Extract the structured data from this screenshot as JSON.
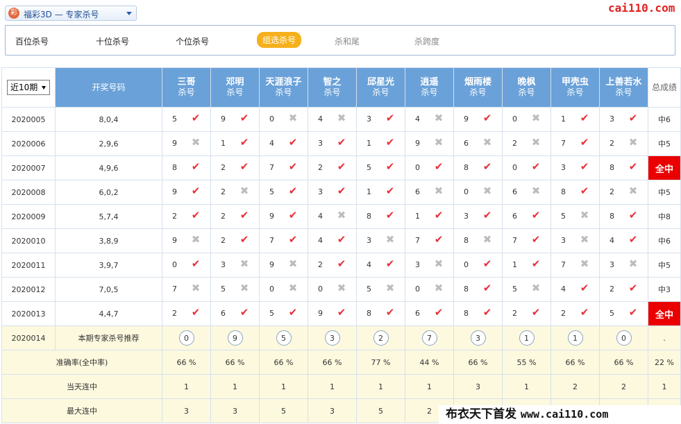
{
  "header": {
    "logo_glyph": "彩",
    "lottery_label": "福彩3D — 专家杀号",
    "brand": "cai110.com"
  },
  "tabs": [
    {
      "label": "百位杀号",
      "state": "normal"
    },
    {
      "label": "十位杀号",
      "state": "normal"
    },
    {
      "label": "个位杀号",
      "state": "normal"
    },
    {
      "label": "组选杀号",
      "state": "active"
    },
    {
      "label": "杀和尾",
      "state": "muted"
    },
    {
      "label": "杀跨度",
      "state": "muted"
    }
  ],
  "table": {
    "period_filter": "近10期",
    "draw_header": "开奖号码",
    "total_header": "总成绩",
    "kill_label": "杀号",
    "experts": [
      "三哥",
      "邓明",
      "天涯浪子",
      "智之",
      "邱星光",
      "逍遥",
      "烟雨楼",
      "晚枫",
      "甲壳虫",
      "上善若水"
    ],
    "rows": [
      {
        "period": "2020005",
        "draw": "8,0,4",
        "cells": [
          [
            "5",
            "hit"
          ],
          [
            "9",
            "hit"
          ],
          [
            "0",
            "miss"
          ],
          [
            "4",
            "miss"
          ],
          [
            "3",
            "hit"
          ],
          [
            "4",
            "miss"
          ],
          [
            "9",
            "hit"
          ],
          [
            "0",
            "miss"
          ],
          [
            "1",
            "hit"
          ],
          [
            "3",
            "hit"
          ]
        ],
        "total": "中6",
        "full": false
      },
      {
        "period": "2020006",
        "draw": "2,9,6",
        "cells": [
          [
            "9",
            "miss"
          ],
          [
            "1",
            "hit"
          ],
          [
            "4",
            "hit"
          ],
          [
            "3",
            "hit"
          ],
          [
            "1",
            "hit"
          ],
          [
            "9",
            "miss"
          ],
          [
            "6",
            "miss"
          ],
          [
            "2",
            "miss"
          ],
          [
            "7",
            "hit"
          ],
          [
            "2",
            "miss"
          ]
        ],
        "total": "中5",
        "full": false
      },
      {
        "period": "2020007",
        "draw": "4,9,6",
        "cells": [
          [
            "8",
            "hit"
          ],
          [
            "2",
            "hit"
          ],
          [
            "7",
            "hit"
          ],
          [
            "2",
            "hit"
          ],
          [
            "5",
            "hit"
          ],
          [
            "0",
            "hit"
          ],
          [
            "8",
            "hit"
          ],
          [
            "0",
            "hit"
          ],
          [
            "3",
            "hit"
          ],
          [
            "8",
            "hit"
          ]
        ],
        "total": "全中",
        "full": true
      },
      {
        "period": "2020008",
        "draw": "6,0,2",
        "cells": [
          [
            "9",
            "hit"
          ],
          [
            "2",
            "miss"
          ],
          [
            "5",
            "hit"
          ],
          [
            "3",
            "hit"
          ],
          [
            "1",
            "hit"
          ],
          [
            "6",
            "miss"
          ],
          [
            "0",
            "miss"
          ],
          [
            "6",
            "miss"
          ],
          [
            "8",
            "hit"
          ],
          [
            "2",
            "miss"
          ]
        ],
        "total": "中5",
        "full": false
      },
      {
        "period": "2020009",
        "draw": "5,7,4",
        "cells": [
          [
            "2",
            "hit"
          ],
          [
            "2",
            "hit"
          ],
          [
            "9",
            "hit"
          ],
          [
            "4",
            "miss"
          ],
          [
            "8",
            "hit"
          ],
          [
            "1",
            "hit"
          ],
          [
            "3",
            "hit"
          ],
          [
            "6",
            "hit"
          ],
          [
            "5",
            "miss"
          ],
          [
            "8",
            "hit"
          ]
        ],
        "total": "中8",
        "full": false
      },
      {
        "period": "2020010",
        "draw": "3,8,9",
        "cells": [
          [
            "9",
            "miss"
          ],
          [
            "2",
            "hit"
          ],
          [
            "7",
            "hit"
          ],
          [
            "4",
            "hit"
          ],
          [
            "3",
            "miss"
          ],
          [
            "7",
            "hit"
          ],
          [
            "8",
            "miss"
          ],
          [
            "7",
            "hit"
          ],
          [
            "3",
            "miss"
          ],
          [
            "4",
            "hit"
          ]
        ],
        "total": "中6",
        "full": false
      },
      {
        "period": "2020011",
        "draw": "3,9,7",
        "cells": [
          [
            "0",
            "hit"
          ],
          [
            "3",
            "miss"
          ],
          [
            "9",
            "miss"
          ],
          [
            "2",
            "hit"
          ],
          [
            "4",
            "hit"
          ],
          [
            "3",
            "miss"
          ],
          [
            "0",
            "hit"
          ],
          [
            "1",
            "hit"
          ],
          [
            "7",
            "miss"
          ],
          [
            "3",
            "miss"
          ]
        ],
        "total": "中5",
        "full": false
      },
      {
        "period": "2020012",
        "draw": "7,0,5",
        "cells": [
          [
            "7",
            "miss"
          ],
          [
            "5",
            "miss"
          ],
          [
            "0",
            "miss"
          ],
          [
            "0",
            "miss"
          ],
          [
            "5",
            "miss"
          ],
          [
            "0",
            "miss"
          ],
          [
            "8",
            "hit"
          ],
          [
            "5",
            "miss"
          ],
          [
            "4",
            "hit"
          ],
          [
            "2",
            "hit"
          ]
        ],
        "total": "中3",
        "full": false
      },
      {
        "period": "2020013",
        "draw": "4,4,7",
        "cells": [
          [
            "2",
            "hit"
          ],
          [
            "6",
            "hit"
          ],
          [
            "5",
            "hit"
          ],
          [
            "9",
            "hit"
          ],
          [
            "8",
            "hit"
          ],
          [
            "6",
            "hit"
          ],
          [
            "8",
            "hit"
          ],
          [
            "2",
            "hit"
          ],
          [
            "2",
            "hit"
          ],
          [
            "5",
            "hit"
          ]
        ],
        "total": "全中",
        "full": true
      }
    ],
    "recommendation": {
      "period": "2020014",
      "label": "本期专家杀号推荐",
      "picks": [
        "0",
        "9",
        "5",
        "3",
        "2",
        "7",
        "3",
        "1",
        "1",
        "0"
      ],
      "total": "."
    },
    "stats": [
      {
        "label": "准确率(全中率)",
        "values": [
          "66 %",
          "66 %",
          "66 %",
          "66 %",
          "77 %",
          "44 %",
          "66 %",
          "55 %",
          "66 %",
          "66 %"
        ],
        "total": "22 %"
      },
      {
        "label": "当天连中",
        "values": [
          "1",
          "1",
          "1",
          "1",
          "1",
          "1",
          "3",
          "1",
          "2",
          "2"
        ],
        "total": "1"
      },
      {
        "label": "最大连中",
        "values": [
          "3",
          "3",
          "5",
          "3",
          "5",
          "2",
          "",
          "",
          "",
          ""
        ],
        "total": ""
      }
    ]
  },
  "watermark": {
    "text_cn": "布衣天下首发",
    "text_url": "www.cai110.com"
  }
}
